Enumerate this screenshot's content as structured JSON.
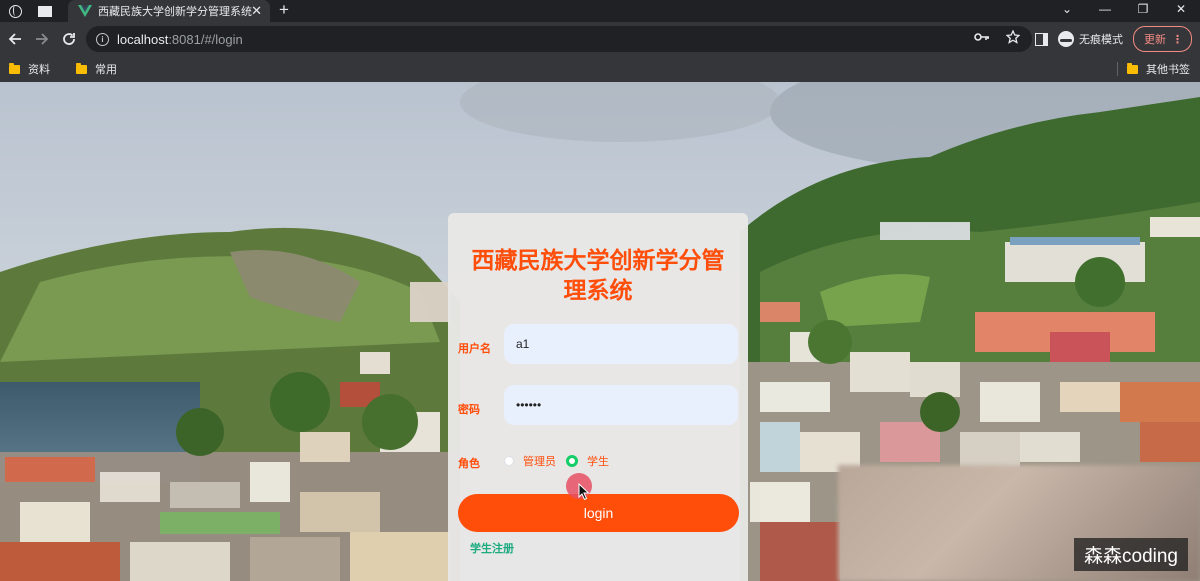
{
  "browser": {
    "tab_title": "西藏民族大学创新学分管理系统",
    "tab_close": "✕",
    "new_tab": "+",
    "url_host": "localhost",
    "url_rest": ":8081/#/login",
    "incognito_label": "无痕模式",
    "update_label": "更新",
    "window_controls": [
      "⌄",
      "—",
      "❐",
      "✕"
    ]
  },
  "bookmarks": {
    "items": [
      "资料",
      "常用"
    ],
    "other": "其他书签"
  },
  "login": {
    "title": "西藏民族大学创新学分管理系统",
    "username_label": "用户名",
    "username_value": "a1",
    "password_label": "密码",
    "password_value": "••••••",
    "role_label": "角色",
    "role_options": [
      "管理员",
      "学生"
    ],
    "role_selected": "学生",
    "login_button": "login",
    "register_link": "学生注册"
  },
  "watermark": "森森coding",
  "colors": {
    "accent": "#ff4d0a",
    "link": "#1aab7f",
    "radio_checked": "#13ce66"
  }
}
